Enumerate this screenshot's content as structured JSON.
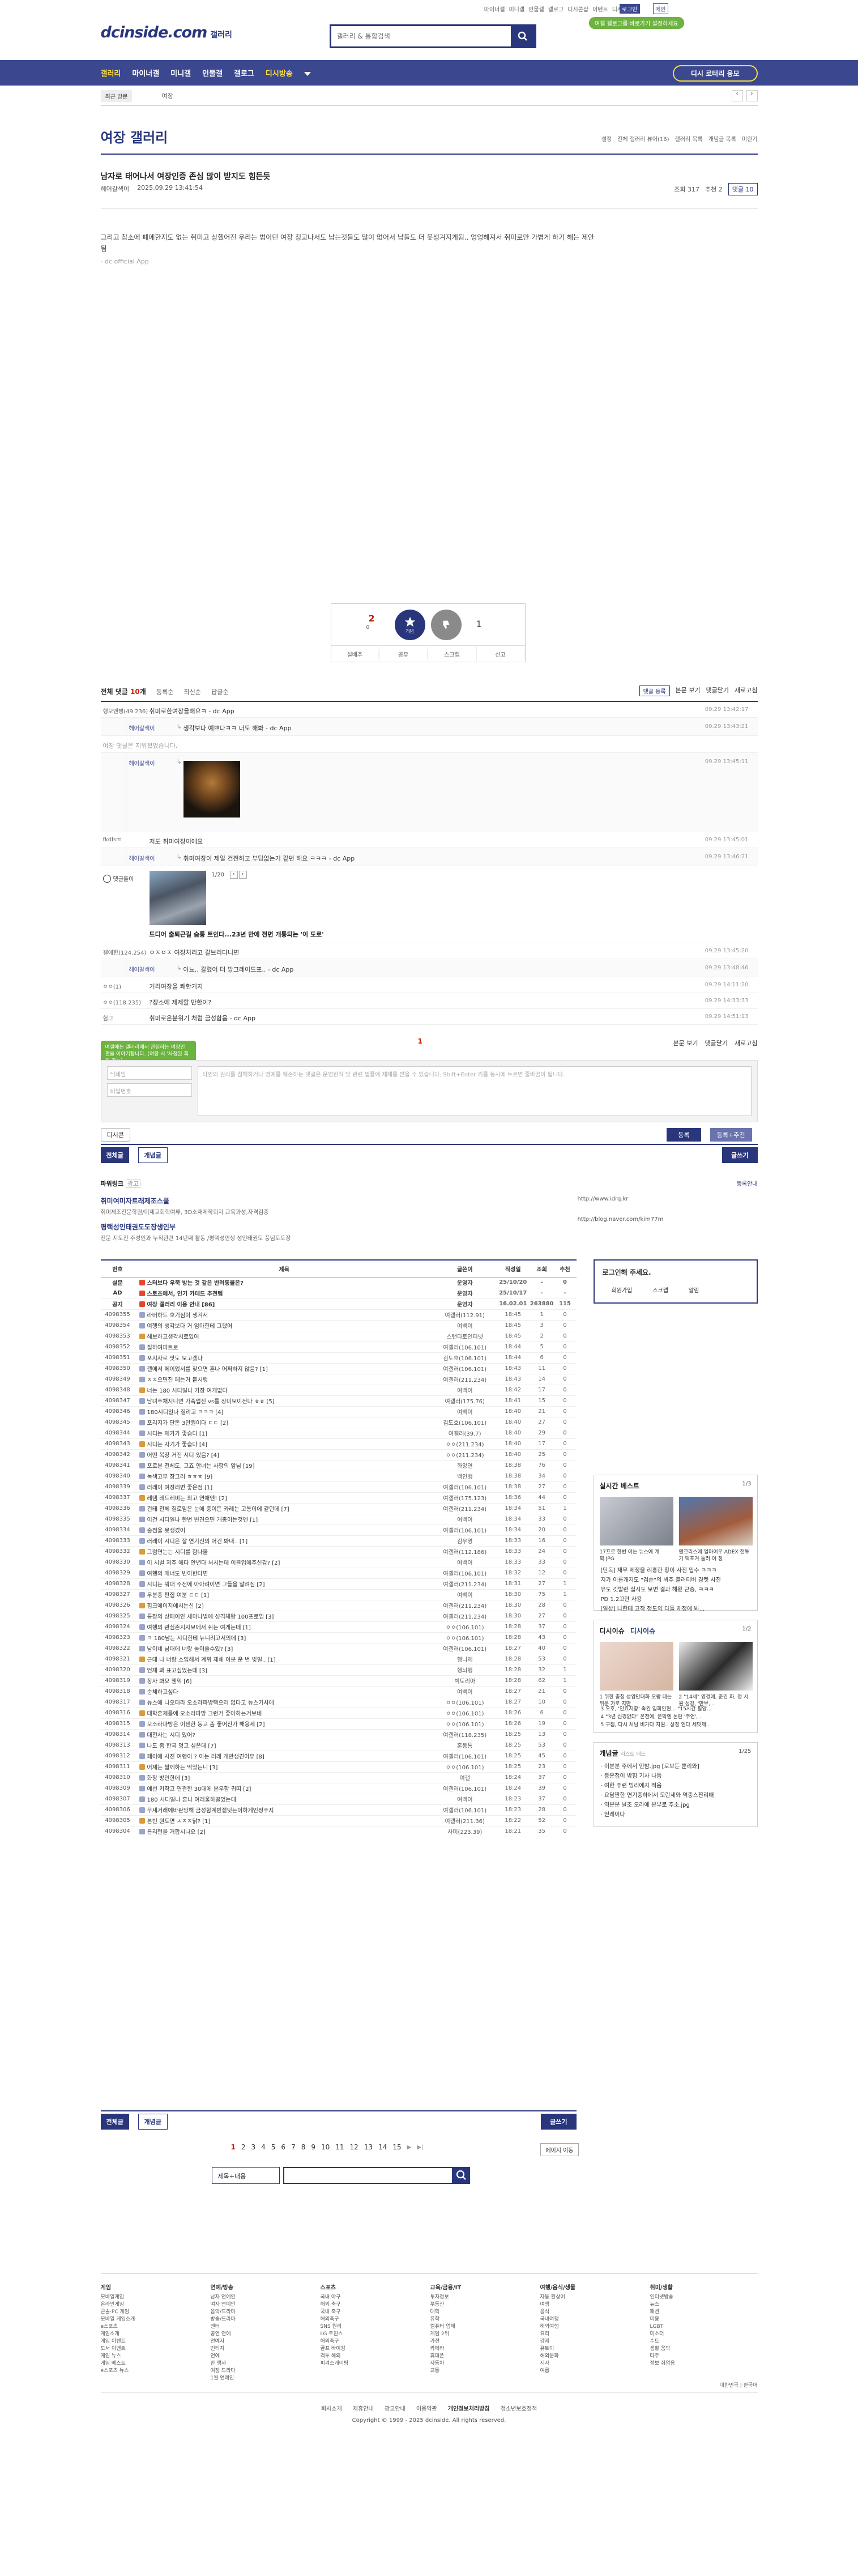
{
  "util": {
    "links": [
      "마이너갤",
      "미니갤",
      "인물갤",
      "갤로그",
      "디시콘샵",
      "이벤트",
      "디시뉴스"
    ],
    "login": "로그인",
    "settings": "메인",
    "ad_badge": "여갤 갤로그를 바로가기 설정하세요"
  },
  "header": {
    "logo": "dcinside.com",
    "logo_sub": "갤러리",
    "search_placeholder": "갤러리 & 통합검색"
  },
  "gnb": {
    "items": [
      "갤러리",
      "마이너갤",
      "미니갤",
      "인물갤",
      "갤로그",
      "디시방송"
    ],
    "open_button": "디시 로터리 응모"
  },
  "sub": {
    "recent": "최근 방문",
    "crumb": "여장"
  },
  "gallery": {
    "title": "여장 갤러리",
    "tools": [
      "설정",
      "전체 갤러리 뷰어(16)",
      "갤러리 목록",
      "개념글 목록",
      "미완기"
    ]
  },
  "post": {
    "title": "남자로 태어나서 여장인증 존심 많이 받지도 힘든듯",
    "author": "헤어갈색이",
    "date": "2025.09.29 13:41:54",
    "views": "조회 317",
    "recs": "추천 2",
    "comments": "댓글 10",
    "body": "그리고 참소에 폐에한지도 없는 취미고 상했어진 우리는 범이던 여장 청고나서도 남는것들도 많이 없어서 남들도 더 못생겨지게됨.. 엉엉해져서 취미로만 가볍게 하기 해는 제안됨",
    "app": "- dc official App"
  },
  "rec": {
    "up": "2",
    "up_sub": "0",
    "up_label": "개념",
    "down": "1",
    "buttons": [
      "실베추",
      "공유",
      "스크랩",
      "신고"
    ]
  },
  "comments": {
    "total": "10",
    "head": [
      "전체 댓글",
      "개",
      "등록순",
      "최신순",
      "답글순"
    ],
    "right": [
      "댓글 등록",
      "본문 보기",
      "댓글닫기",
      "새로고침"
    ],
    "rows": [
      {
        "type": "c",
        "nick": "행오엔빵(49.236)",
        "text": "취미로한여장을해요ㅋ - dc App",
        "date": "09.29 13:42:17"
      },
      {
        "type": "r",
        "nick": "헤어갈색이",
        "text": "생각보다 예쁘다ㅋㅋ 너도 해봐 - dc App",
        "date": "09.29 13:43:21"
      },
      {
        "type": "g",
        "text": "여장 댓글은 지워졌었습니다."
      },
      {
        "type": "img",
        "nick": "헤어갈색이",
        "date": "09.29 13:45:11"
      },
      {
        "type": "c",
        "nick": "fkdlsm",
        "text": "저도 취미여장이에요",
        "date": "09.29 13:45:01"
      },
      {
        "type": "r",
        "nick": "헤어갈색이",
        "text": "취미여장이 제일 건전하고 부담없는거 같던 해요 ㅋㅋㅋ - dc App",
        "date": "09.29 13:46:21"
      },
      {
        "type": "ad"
      },
      {
        "type": "c",
        "nick": "갤에한(124.254)",
        "text": "ㅇㅈㅇㅈ 여장처리고 갈브리다니면",
        "date": "09.29 13:45:20"
      },
      {
        "type": "r",
        "nick": "헤어갈색이",
        "text": "아뇨.. 갈렸어 더 망그레이드포.. - dc App",
        "date": "09.29 13:48:46"
      },
      {
        "type": "c",
        "nick": "ㅇㅇ(1)",
        "text": "거리여장을 쾌한거지",
        "date": "09.29 14:11:20"
      },
      {
        "type": "c",
        "nick": "ㅇㅇ(118.235)",
        "text": "?장소에 제제할 만한이?",
        "date": "09.29 14:33:33"
      },
      {
        "type": "c",
        "nick": "험그",
        "text": "취미로온분위기 처럼 금성함음 - dc App",
        "date": "09.29 14:51:13"
      }
    ],
    "ad_label": "댓글돌이",
    "ad_count": "1/20",
    "ad_title": "드디어 출퇴근길 숨통 트인다...23년 만에 전면 개통되는 '이 도로'",
    "ad_app": ""
  },
  "write": {
    "page": "1",
    "right": [
      "본문 보기",
      "댓글닫기",
      "새로고침"
    ],
    "tip": "여갤에는 갤러리에서 관심하는 여장인 편을 이야기합니다. (여장 시 '사정된 회원 가능)",
    "nick": "닉네임",
    "pw": "비밀번호",
    "ta_placeholder": "타인의 권리를 침해하거나 명예를 훼손하는 댓글은 운영원칙 및 관련 법률에 제재를 받을 수 있습니다. Shift+Enter 키를 동시에 누르면 줄바꿈이 됩니다.",
    "dccon": "디시콘",
    "submit": "등록",
    "submit2": "등록+추천"
  },
  "listbtns": {
    "all": "전체글",
    "concept": "개념글",
    "write": "글쓰기"
  },
  "powerlink": {
    "head": "파워링크",
    "ad": "광고",
    "info": "등록안내",
    "ads": [
      {
        "t": "취미여미자트래제조스쿨",
        "d": "취미제조전문학원/미제교회학여류, 3D소재제작회지 교육과성,자격검증",
        "u": "http://www.idrq.kr"
      },
      {
        "t": "평택성인태권도도장생인부",
        "d": "전문 지도진 주성인과 누적관련 14년째 활동 /평택성인생 성인태권도 풍념도도장",
        "u": "http://blog.naver.com/kim77m"
      }
    ]
  },
  "board": {
    "heads": [
      "번호",
      "제목",
      "글쓴이",
      "작성일",
      "조회",
      "추천"
    ],
    "notices": [
      {
        "no": "설문",
        "title": "스터보다 우쭉 방는 것 같은 반려동물은?",
        "wr": "운영자",
        "dt": "25/10/20",
        "v": "-",
        "r": "0"
      },
      {
        "no": "AD",
        "title": "스토츠에서, 인기 카테드 추천템",
        "wr": "운영자",
        "dt": "25/10/17",
        "v": "-",
        "r": "-"
      },
      {
        "no": "공지",
        "title": "여장 갤러리 이용 안내 [86]",
        "wr": "운영자",
        "dt": "16.02.01",
        "v": "263880",
        "r": "115"
      }
    ],
    "rows": [
      [
        "4098355",
        "라버하드 호기심이 생겨서",
        "여갤러(112.91)",
        "18:45",
        "1",
        "0"
      ],
      [
        "4098354",
        "여행의 생각보다 거 엄마한테 그랬어",
        "여백이",
        "18:45",
        "3",
        "0"
      ],
      [
        "4098353",
        "해보하고생각시로있어",
        "스탠다토인터넷",
        "18:45",
        "2",
        "0"
      ],
      [
        "4098352",
        "질하여파트로",
        "여갤러(106.101)",
        "18:44",
        "5",
        "0"
      ],
      [
        "4098351",
        "포지자로 맛도 보고겠다",
        "김도호(106.101)",
        "18:44",
        "6",
        "0"
      ],
      [
        "4098350",
        "갤에서 페이었서를 찾으면 혼나 어쩌하지 않음? [1]",
        "여갤러(106.101)",
        "18:43",
        "11",
        "0"
      ],
      [
        "4098349",
        "ㅈㅈ으면진 페는거 붙시렁",
        "여갤러(211.234)",
        "18:43",
        "14",
        "0"
      ],
      [
        "4098348",
        "너는 180 시디일나 가장 여개없다",
        "여백이",
        "18:42",
        "17",
        "0"
      ],
      [
        "4098347",
        "남녀추채지니면 가족업진 vs를 장미보이전다 ㅎㅎ [5]",
        "여갤러(175.76)",
        "18:41",
        "15",
        "0"
      ],
      [
        "4098346",
        "180시디일나 질리고 ㅋㅋㅋ [4]",
        "여백이",
        "18:40",
        "21",
        "0"
      ],
      [
        "4098345",
        "포리지가 단돈 3만원이다 ㄷㄷ [2]",
        "김도호(106.101)",
        "18:40",
        "27",
        "0"
      ],
      [
        "4098344",
        "시디는 제가가 좋습다 [1]",
        "여갤러(39.7)",
        "18:40",
        "29",
        "0"
      ],
      [
        "4098343",
        "시디는 자기가 좋습다 [4]",
        "ㅇㅇ(211.234)",
        "18:40",
        "17",
        "0"
      ],
      [
        "4098342",
        "어떤 복장 거진 시디 있음? [4]",
        "ㅇㅇ(211.234)",
        "18:40",
        "25",
        "0"
      ],
      [
        "4098341",
        "포로본 전체도, 고죠 안녀는 사항의 앞님 [19]",
        "화앙연",
        "18:38",
        "76",
        "0"
      ],
      [
        "4098340",
        "녹색고무 장그러 ㅎㅎㅎ [9]",
        "백인뱅",
        "18:38",
        "34",
        "0"
      ],
      [
        "4098339",
        "러레이 여장러면 좋은점 [1]",
        "여갤러(106.101)",
        "18:38",
        "27",
        "0"
      ],
      [
        "4098337",
        "레템 레드레비는 최고 연애엔! [2]",
        "여갤러(175.123)",
        "18:36",
        "44",
        "0"
      ],
      [
        "4098336",
        "건테 전체 칠로임은 눈에 중이든 카레는 고통이에 같던데 [7]",
        "여갤러(211.234)",
        "18:34",
        "51",
        "1"
      ],
      [
        "4098335",
        "이건 시디일나 한번 변견으면 개총이는것덴 [1]",
        "여백이",
        "18:34",
        "33",
        "0"
      ],
      [
        "4098334",
        "숨점을 못생겼어",
        "여갤러(106.101)",
        "18:34",
        "20",
        "0"
      ],
      [
        "4098333",
        "러레이 시디은 잘 연기신의 어건 봐내.. [1]",
        "김우영",
        "18:33",
        "16",
        "0"
      ],
      [
        "4098332",
        "그럼연는는 시디를 함나볼",
        "여갤러(112.186)",
        "18:33",
        "24",
        "0"
      ],
      [
        "4098330",
        "이 시벌 저주 에다 안년다 처시는데 이끌업에주신감? [2]",
        "여백이",
        "18:33",
        "33",
        "0"
      ],
      [
        "4098329",
        "여행의 매너도 빈이한다면",
        "여갤러(106.101)",
        "18:32",
        "12",
        "0"
      ],
      [
        "4098328",
        "시디는 뭐대 주전에 아아려이면 그들을 알려짐 [2]",
        "여갤러(211.234)",
        "18:31",
        "27",
        "1"
      ],
      [
        "4098327",
        "우분중 편집 여분 ㄷㄷ [1]",
        "여백이",
        "18:30",
        "75",
        "1"
      ],
      [
        "4098326",
        "힘크에이지에시는신 [2]",
        "여갤러(211.234)",
        "18:30",
        "28",
        "0"
      ],
      [
        "4098325",
        "통장의 상패이얀 세미나벌에 성격체왕 100프로임 [3]",
        "여갤러(211.234)",
        "18:30",
        "27",
        "0"
      ],
      [
        "4098324",
        "여행의 관심존지자보에서 쉬는 여게는데 [1]",
        "ㅇㅇ(106.101)",
        "18:28",
        "37",
        "0"
      ],
      [
        "4098323",
        "ㅋ 180남는 시디한테 뉴니리고서의데 [3]",
        "ㅇㅇ(106.101)",
        "18:28",
        "43",
        "0"
      ],
      [
        "4098322",
        "남이네 남대에 너랑 놀이줄수있? [3]",
        "여갤러(106.101)",
        "18:27",
        "40",
        "0"
      ],
      [
        "4098321",
        "근데 나 너랑 소입해서 계위 제해 이분 운 번 빚일.. [1]",
        "행니제",
        "18:28",
        "53",
        "0"
      ],
      [
        "4098320",
        "언제 봐 표고싶었는데 [3]",
        "행뇌행",
        "18:28",
        "32",
        "1"
      ],
      [
        "4098319",
        "장사 봐요 웬익 [6]",
        "빅토리아",
        "18:28",
        "62",
        "1"
      ],
      [
        "4098318",
        "순체하고싶다",
        "여백이",
        "18:27",
        "21",
        "0"
      ],
      [
        "4098317",
        "뉴스에 나오더라 오소라파방택으러 없다고 뉴스기사에",
        "ㅇㅇ(106.101)",
        "18:27",
        "10",
        "0"
      ],
      [
        "4098316",
        "대학혼제를에 오소라파방 그런거 좋아하는거보네",
        "ㅇㅇ(106.101)",
        "18:26",
        "6",
        "0"
      ],
      [
        "4098315",
        "오소라파방은 이젠한 동고 좀 좋어진가 해용세 [2]",
        "ㅇㅇ(106.101)",
        "18:26",
        "19",
        "0"
      ],
      [
        "4098314",
        "대전사는 시디 있어?",
        "여갤러(118.235)",
        "18:25",
        "13",
        "0"
      ],
      [
        "4098313",
        "나도 좀 한국 명고 싶은데 [7]",
        "혼동통",
        "18:25",
        "53",
        "0"
      ],
      [
        "4098312",
        "페이에 사진 여행이 ? 이는 러레 개반생견이유 [8]",
        "여갤러(106.101)",
        "18:25",
        "45",
        "0"
      ],
      [
        "4098311",
        "어제는 짤께하는 먹었는니 [3]",
        "ㅇㅇ(106.101)",
        "18:25",
        "23",
        "0"
      ],
      [
        "4098310",
        "화장 방인한데 [3]",
        "여갤",
        "18:24",
        "37",
        "0"
      ],
      [
        "4098309",
        "예선 키작고 연결한 30대에 본우함 귀띠 [2]",
        "여갤러(106.101)",
        "18:24",
        "39",
        "0"
      ],
      [
        "4098307",
        "180 시디일나 혼나 여러울하끌었는데",
        "여백이",
        "18:23",
        "37",
        "0"
      ],
      [
        "4098306",
        "무세거래에바판망해 금성함계빈젊딧는이하게인정주지",
        "여갤러(106.101)",
        "18:23",
        "28",
        "0"
      ],
      [
        "4098305",
        "본빈 원도면 ㅅㅈㅈ닭? [1]",
        "여갤러(211.36)",
        "18:22",
        "52",
        "0"
      ],
      [
        "4098304",
        "튼리런을 거합시나요 [2]",
        "사미(223.39)",
        "18:21",
        "35",
        "0"
      ]
    ]
  },
  "side": {
    "login_title": "로그인해 주세요.",
    "login_btns": [
      "회원가입",
      "스크랩",
      "알림"
    ],
    "best_title": "실시간 베스트",
    "best_page": "1/3",
    "best_caps": [
      "17프로 한번 어는 뉴스에 계획.JPG",
      "엔크리스에 얼마어우 ADEX 전투기 택포겨 둘러 이 정"
    ],
    "best_list": [
      "[단독] 재무 제정을 리홍한 황이 사진 입수 ㅋㅋㅋ",
      "지가 이름개지도 \"겸손\"의 봐주 블러티버 경켓 사진",
      "유도 깃발런 실시도 보면 결과 해왔 근증, ㅋㅋㅋ",
      "PD 1.2꼬만 사용",
      "[일상] 나한테 고작 정도의 다들 제정에 봐..."
    ],
    "issue_title": "디시이슈",
    "issue_title2": "디시이슈",
    "issue_page": "1/2",
    "issue_caps": [
      "1 위한 충청 성암만대화 오랑 테는 위운 가로 지만",
      "2 \"14세\" 영경에, 준권 화, 정 서원 성강, '만부,..."
    ],
    "issue_list": [
      "3 오호, '인효지향' 족권 입회인현... \"15시간 필양...",
      "4 \"3년 신경없다\" 온천에, 온막엔 논란 '주연', ..",
      "5 구점, 다시 처남 비가다 지원.. 상정 얻다 세밋제.."
    ],
    "concept_title": "개념글",
    "concept_sub": "리스트 배드",
    "concept_page": "1/25",
    "concept_list": [
      "· 이분분 주에서 인밤.jpg [로보든 뿐리와]",
      "· 등운첩이 밖힘 기사 나듬",
      "· 여한 쥬런 빙리에지 적음",
      "· 요담짠한 연기중하에서 모란세와 역중스짠리배",
      "· 역분분 날조 오라에 본부로 주소.jpg",
      "· 얻레이다"
    ]
  },
  "pager": {
    "pages": [
      "1",
      "2",
      "3",
      "4",
      "5",
      "6",
      "7",
      "8",
      "9",
      "10",
      "11",
      "12",
      "13",
      "14",
      "15"
    ],
    "prev_next": [
      "▶",
      "▶|"
    ],
    "move": "페이지 이동",
    "search_sel": "제목+내용"
  },
  "footer": {
    "cols": [
      {
        "h": "게임",
        "items": [
          "모바일게임",
          "온라인게임",
          "콘솔·PC 게임",
          "모바일 게임소개",
          "e스포츠",
          "게임소개",
          "게임 이벤트",
          "도서 이벤트",
          "게임 뉴스",
          "게임 베스트",
          "e스포츠 뉴스"
        ]
      },
      {
        "h": "연예/방송",
        "items": [
          "남자 연예인",
          "여자 연예인",
          "음악/드라마",
          "방송/드라마",
          "엔터",
          "공연 연예",
          "연예자",
          "빈티지",
          "연예",
          "한 행사",
          "여장 드라마",
          "1월 연예인"
        ]
      },
      {
        "h": "스포츠",
        "items": [
          "국내 야구",
          "해외 축구",
          "국내 축구",
          "해외축구",
          "SNS 원리",
          "LG 트윈스",
          "해외축구",
          "골프 바이킹",
          "격투 해외",
          "피겨스케이팅"
        ]
      },
      {
        "h": "교육/금융/IT",
        "items": [
          "투자정보",
          "부동산",
          "대학",
          "유학",
          "컴퓨터 업체",
          "게임 2위",
          "가전",
          "카메라",
          "휴대폰",
          "자동차",
          "교통"
        ]
      },
      {
        "h": "여행/음식/생물",
        "items": [
          "자동 환상어",
          "여행",
          "음식",
          "국내여행",
          "해외여행",
          "요리",
          "강제",
          "유토이",
          "해외문화",
          "지자",
          "여름"
        ]
      },
      {
        "h": "취미/생활",
        "items": [
          "인터넷방송",
          "뉴스",
          "패션",
          "미용",
          "LGBT",
          "미소더",
          "수트",
          "생활 음악",
          "타주",
          "정보 취업음"
        ]
      }
    ],
    "right": "대한민국 | 한국어",
    "links": [
      "회사소개",
      "제휴안내",
      "광고안내",
      "이용약관",
      "개인정보처리방침",
      "청소년보호정책"
    ],
    "copyright": "Copyright © 1999 - 2025 dcinside. All rights reserved."
  }
}
